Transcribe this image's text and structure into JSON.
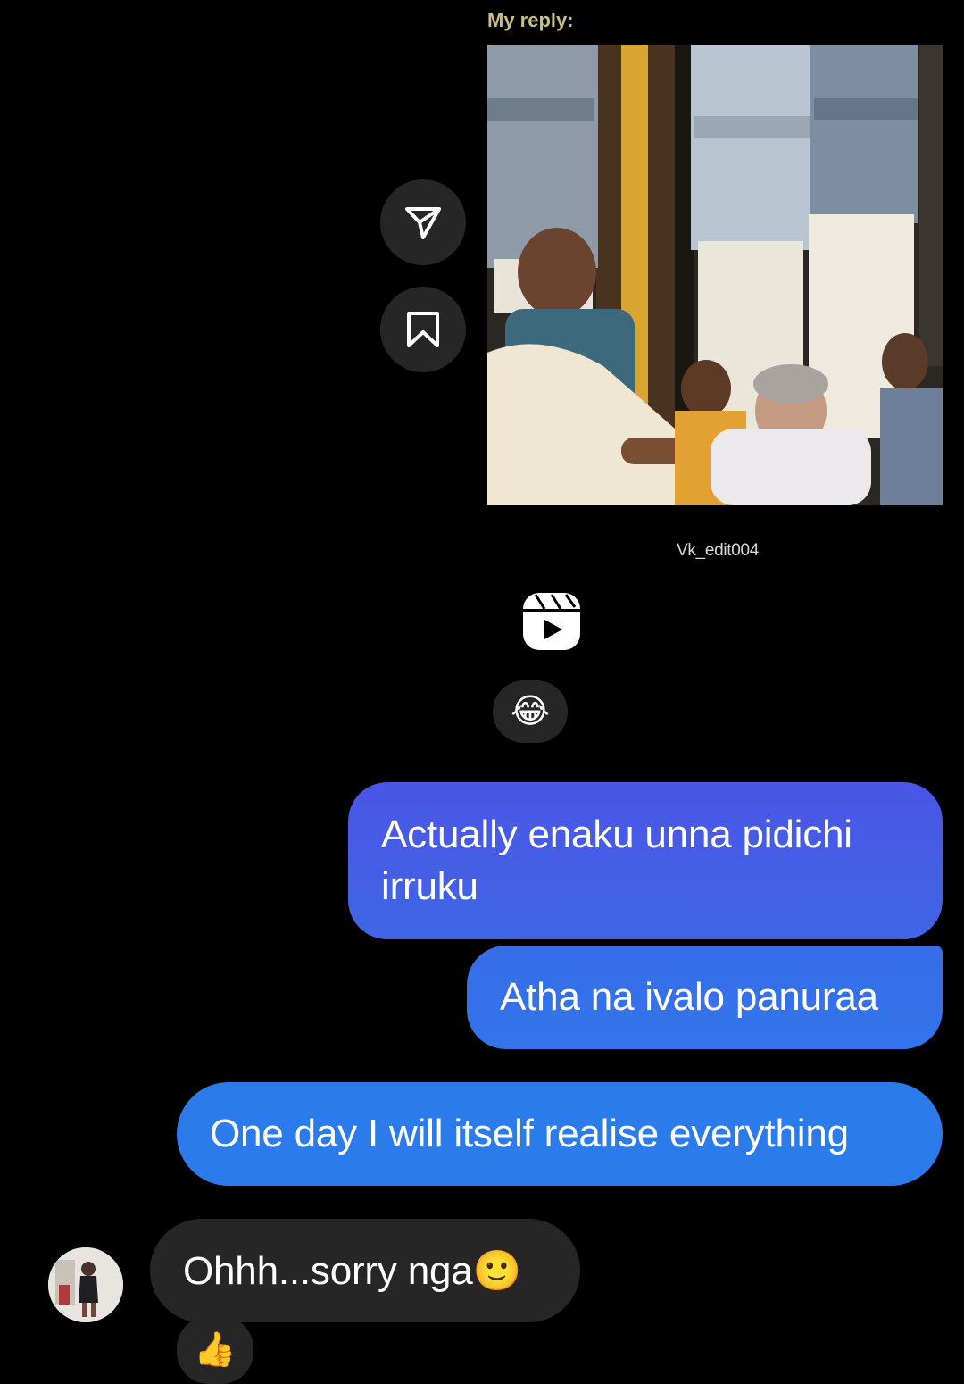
{
  "reply_caption": "My reply:",
  "reel": {
    "watermark": "Vk_edit004"
  },
  "actions": {
    "share_icon": "paper-plane-icon",
    "save_icon": "bookmark-icon",
    "reels_icon": "reels-icon"
  },
  "reactions": {
    "on_reel": "😂",
    "on_incoming": "👍"
  },
  "messages": {
    "outgoing": [
      "Actually enaku unna pidichi irruku",
      "Atha na ivalo panuraa",
      "One day I will itself realise everything"
    ],
    "incoming": [
      "Ohhh...sorry nga🙂"
    ]
  },
  "colors": {
    "bubble_out_gradient_top": "#4b55e6",
    "bubble_out_bottom": "#2c7bea",
    "bubble_in": "#262626",
    "caption": "#c8bf86",
    "background": "#000000"
  }
}
